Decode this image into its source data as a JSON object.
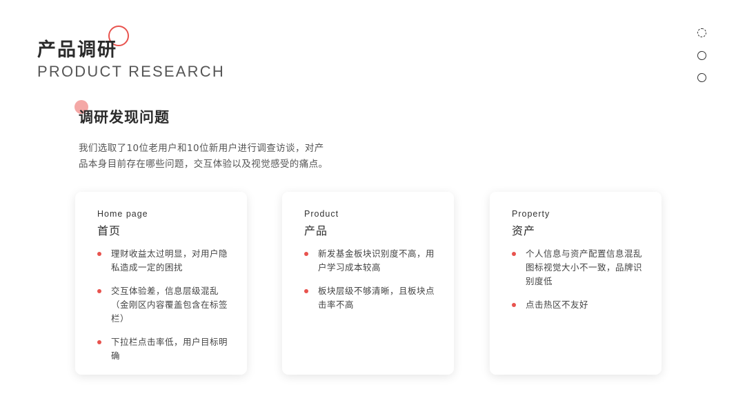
{
  "header": {
    "title_zh": "产品调研",
    "title_en": "PRODUCT RESEARCH"
  },
  "section": {
    "title": "调研发现问题",
    "intro_line1": "我们选取了10位老用户和10位新用户进行调查访谈，对产",
    "intro_line2": "品本身目前存在哪些问题，交互体验以及视觉感受的痛点。"
  },
  "cards": [
    {
      "en": "Home page",
      "zh": "首页",
      "items": [
        "理财收益太过明显，对用户隐私造成一定的困扰",
        "交互体验差，信息层级混乱（金刚区内容覆盖包含在标签栏）",
        "下拉栏点击率低，用户目标明确"
      ]
    },
    {
      "en": "Product",
      "zh": "产品",
      "items": [
        "新发基金板块识别度不高，用户学习成本较高",
        "板块层级不够清晰，且板块点击率不高"
      ]
    },
    {
      "en": "Property",
      "zh": "资产",
      "items": [
        "个人信息与资产配置信息混乱图标视觉大小不一致，品牌识别度低",
        "点击热区不友好"
      ]
    }
  ],
  "colors": {
    "accent": "#e8534e",
    "accent_light": "#f4a8a6",
    "text_dark": "#2b2b2b",
    "text_body": "#555555"
  },
  "icons": {
    "title_decoration": "ring-circle",
    "section_decoration": "filled-circle",
    "nav": [
      "dashed-circle",
      "circle",
      "circle"
    ]
  }
}
